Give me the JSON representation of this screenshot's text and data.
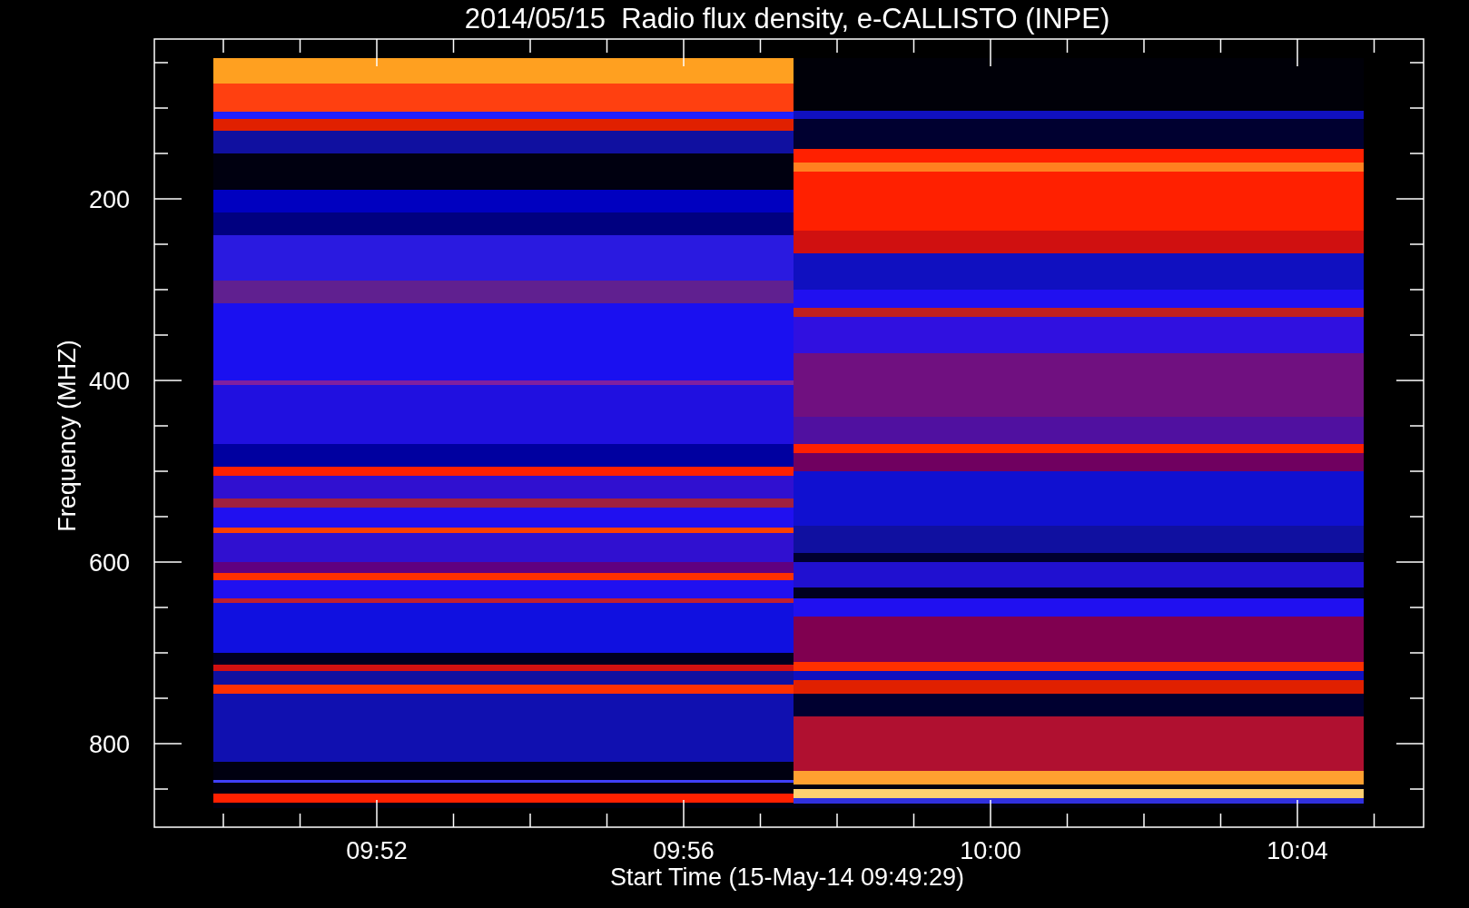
{
  "title": "2014/05/15  Radio flux density, e-CALLISTO (INPE)",
  "y_axis": {
    "label": "Frequency (MHZ)",
    "ticks": [
      "200",
      "400",
      "600",
      "800"
    ]
  },
  "x_axis": {
    "label": "Start Time (15-May-14 09:49:29)",
    "ticks": [
      "09:52",
      "09:56",
      "10:00",
      "10:04"
    ]
  }
}
